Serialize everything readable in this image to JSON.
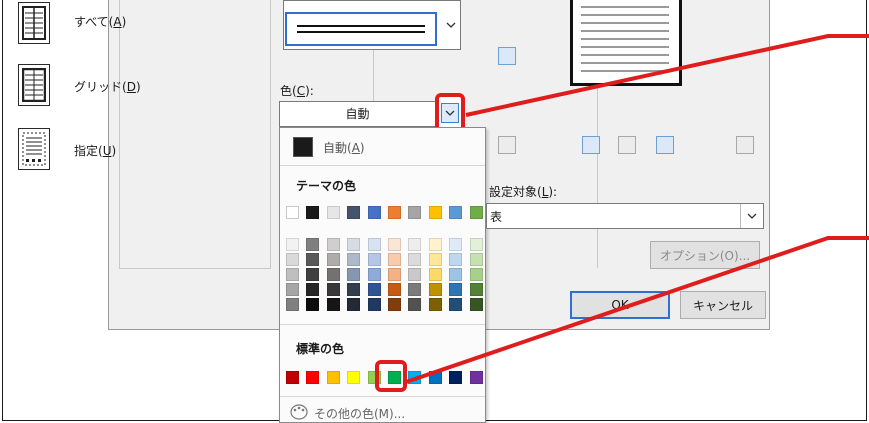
{
  "presets": {
    "all": {
      "label": "すべて(A)",
      "text": "すべて(",
      "key": "A",
      "end": ")"
    },
    "grid": {
      "label": "グリッド(D)",
      "text": "グリッド(",
      "key": "D",
      "end": ")"
    },
    "custom": {
      "label": "指定(U)",
      "text": "指定(",
      "key": "U",
      "end": ")"
    }
  },
  "color": {
    "label_text": "色(",
    "label_key": "C",
    "label_end": "):",
    "selected": "自動"
  },
  "dropdown": {
    "auto_text": "自動(",
    "auto_key": "A",
    "auto_end": ")",
    "theme_title": "テーマの色",
    "standard_title": "標準の色",
    "more_label": "その他の色(M)...",
    "theme_top": [
      "#ffffff",
      "#1a1a1a",
      "#e7e6e6",
      "#44546a",
      "#4472c4",
      "#ed7d31",
      "#a5a5a5",
      "#ffc000",
      "#5b9bd5",
      "#70ad47"
    ],
    "theme_shades": [
      [
        "#f2f2f2",
        "#d9d9d9",
        "#bfbfbf",
        "#a6a6a6",
        "#808080"
      ],
      [
        "#7f7f7f",
        "#595959",
        "#3f3f3f",
        "#262626",
        "#0d0d0d"
      ],
      [
        "#d0cece",
        "#aeabab",
        "#757171",
        "#3a3838",
        "#171616"
      ],
      [
        "#d6dce4",
        "#adb9ca",
        "#8497b0",
        "#333f4f",
        "#222a35"
      ],
      [
        "#d9e2f3",
        "#b4c6e7",
        "#8eaadb",
        "#2f5496",
        "#1f3864"
      ],
      [
        "#fbe5d5",
        "#f7cbac",
        "#f4b183",
        "#c55a11",
        "#833c0b"
      ],
      [
        "#ededed",
        "#dbdbdb",
        "#c9c9c9",
        "#7b7b7b",
        "#525252"
      ],
      [
        "#fff2cc",
        "#ffe699",
        "#ffd966",
        "#bf9000",
        "#7f6000"
      ],
      [
        "#deebf6",
        "#bdd7ee",
        "#9dc3e6",
        "#2e75b5",
        "#1f4e79"
      ],
      [
        "#e2efd9",
        "#c5e0b3",
        "#a8d08d",
        "#538135",
        "#375623"
      ]
    ],
    "standard": [
      "#c00000",
      "#ff0000",
      "#ffc000",
      "#ffff00",
      "#92d050",
      "#00b050",
      "#00b0f0",
      "#0070c0",
      "#002060",
      "#7030a0"
    ]
  },
  "apply": {
    "label_text": "設定対象(",
    "label_key": "L",
    "label_end": "):",
    "value": "表"
  },
  "buttons": {
    "options": "オプション(O)...",
    "ok": "OK",
    "cancel": "キャンセル"
  },
  "colors": {
    "highlight": "#e01d1d",
    "focus": "#2f6fcf"
  }
}
